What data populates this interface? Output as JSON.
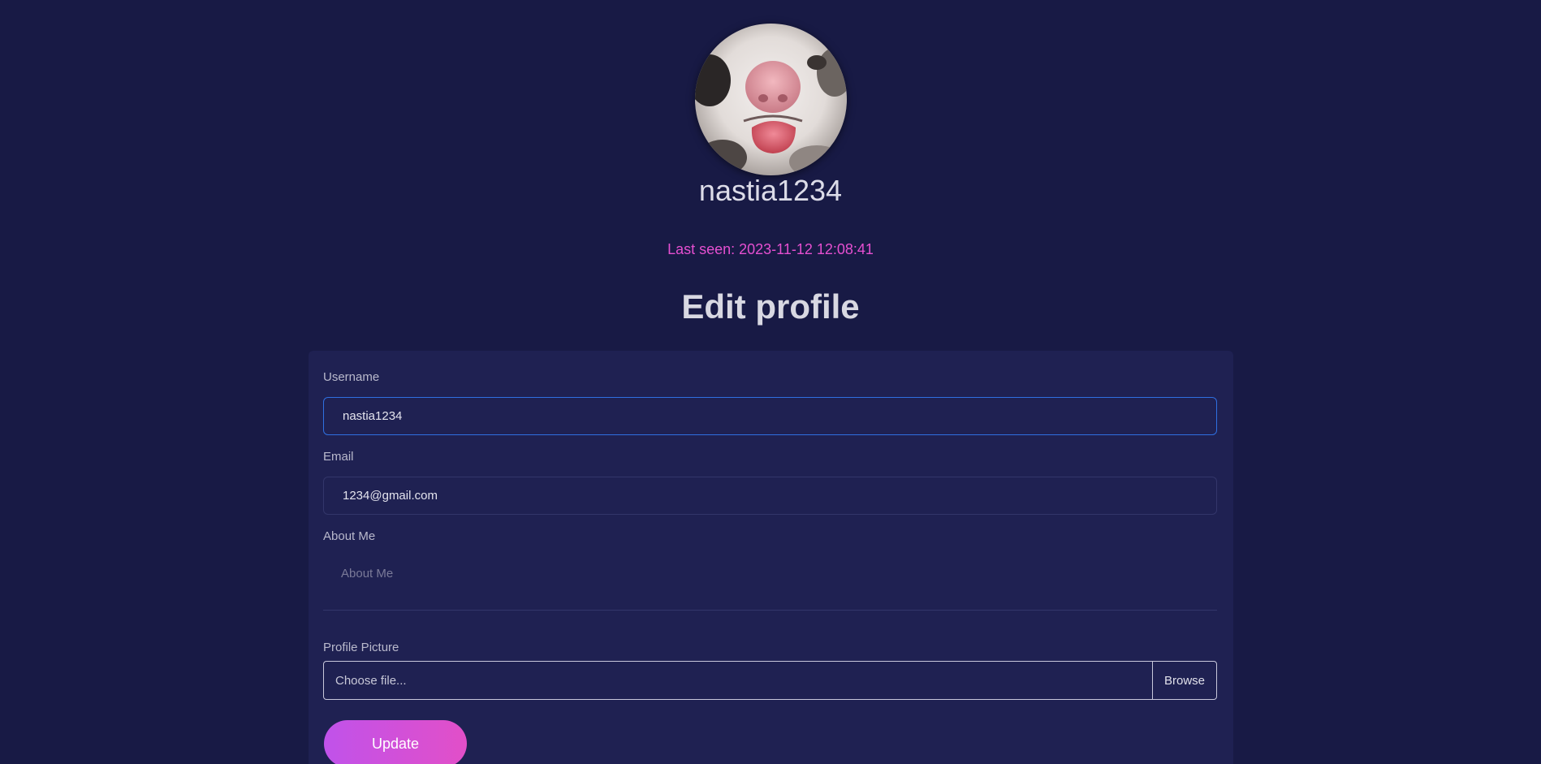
{
  "profile": {
    "username": "nastia1234",
    "last_seen": "Last seen: 2023-11-12 12:08:41",
    "avatar_icon": "profile-photo-cat-icon"
  },
  "form": {
    "title": "Edit profile",
    "username_label": "Username",
    "username_value": "nastia1234",
    "email_label": "Email",
    "email_value": "1234@gmail.com",
    "about_label": "About Me",
    "about_placeholder": "About Me",
    "picture_label": "Profile Picture",
    "file_placeholder": "Choose file...",
    "browse_label": "Browse",
    "update_label": "Update"
  },
  "colors": {
    "background": "#181a45",
    "card": "#1f2152",
    "accent_pink": "#e54fd0",
    "focus_blue": "#2f6fe0",
    "button_gradient_start": "#c052ea",
    "button_gradient_end": "#e24fc8"
  }
}
